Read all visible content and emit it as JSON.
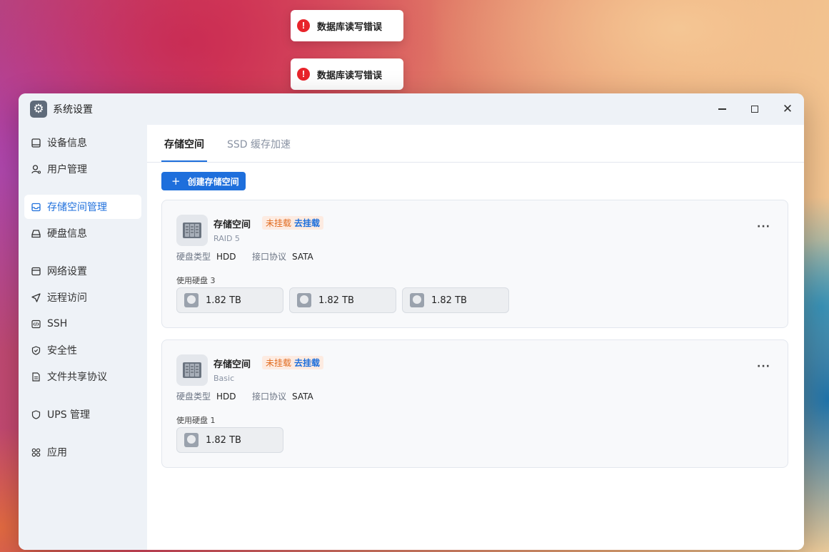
{
  "toasts": [
    {
      "message": "数据库读写错误"
    },
    {
      "message": "数据库读写错误"
    }
  ],
  "window": {
    "title": "系统设置"
  },
  "sidebar": {
    "items": [
      {
        "label": "设备信息",
        "icon": "monitor-icon"
      },
      {
        "label": "用户管理",
        "icon": "user-icon"
      },
      {
        "label": "存储空间管理",
        "icon": "storage-icon",
        "active": true
      },
      {
        "label": "硬盘信息",
        "icon": "disk-icon"
      },
      {
        "label": "网络设置",
        "icon": "network-icon"
      },
      {
        "label": "远程访问",
        "icon": "send-icon"
      },
      {
        "label": "SSH",
        "icon": "code-icon"
      },
      {
        "label": "安全性",
        "icon": "shield-check-icon"
      },
      {
        "label": "文件共享协议",
        "icon": "file-icon"
      },
      {
        "label": "UPS 管理",
        "icon": "shield-icon"
      },
      {
        "label": "应用",
        "icon": "apps-icon"
      }
    ]
  },
  "tabs": [
    {
      "label": "存储空间",
      "active": true
    },
    {
      "label": "SSD 缓存加速"
    }
  ],
  "create_button": "创建存储空间",
  "colors": {
    "accent": "#1e6fdc",
    "error": "#e8242b",
    "warning_text": "#e06a1e"
  },
  "storage_pools": [
    {
      "title": "存储空间",
      "status": "未挂载",
      "action": "去挂载",
      "raid": "RAID 5",
      "disk_type_label": "硬盘类型",
      "disk_type": "HDD",
      "protocol_label": "接口协议",
      "protocol": "SATA",
      "used_disks_label": "使用硬盘 3",
      "more": "···",
      "disks": [
        "1.82 TB",
        "1.82 TB",
        "1.82 TB"
      ]
    },
    {
      "title": "存储空间",
      "status": "未挂载",
      "action": "去挂载",
      "raid": "Basic",
      "disk_type_label": "硬盘类型",
      "disk_type": "HDD",
      "protocol_label": "接口协议",
      "protocol": "SATA",
      "used_disks_label": "使用硬盘 1",
      "more": "···",
      "disks": [
        "1.82 TB"
      ]
    }
  ]
}
